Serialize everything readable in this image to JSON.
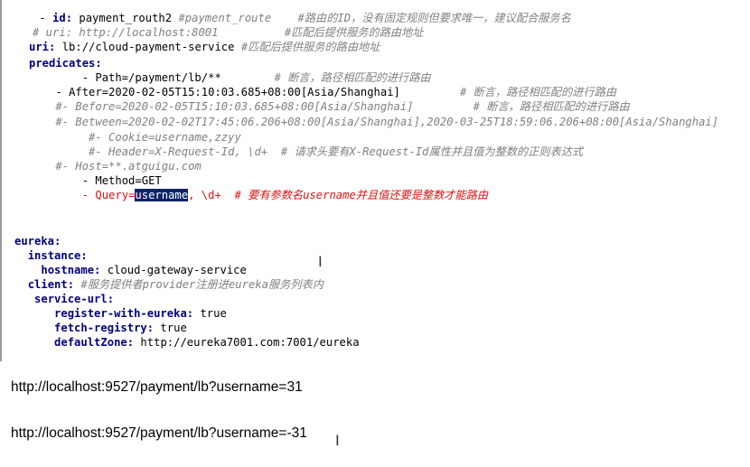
{
  "code": {
    "l1": {
      "dash": "    - ",
      "key": "id:",
      "val": " payment_routh2 ",
      "comment": "#payment_route    #路由的ID，没有固定规则但要求唯一，建议配合服务名"
    },
    "l2": {
      "comment": "   # uri: http://localhost:8001          #匹配后提供服务的路由地址"
    },
    "l3": {
      "indent": "   ",
      "key": "uri:",
      "val": " lb://cloud-payment-service ",
      "comment": "#匹配后提供服务的路由地址"
    },
    "l4": {
      "indent": "   ",
      "key": "predicates:"
    },
    "l5": {
      "val": "        - Path=/payment/lb/**        ",
      "comment": "# 断言，路径相匹配的进行路由"
    },
    "l6": {
      "val": "    - After=2020-02-05T15:10:03.685+08:00[Asia/Shanghai]         ",
      "comment": "# 断言，路径相匹配的进行路由"
    },
    "l7": {
      "comment": "    #- Before=2020-02-05T15:10:03.685+08:00[Asia/Shanghai]         # 断言，路径相匹配的进行路由"
    },
    "l8": {
      "comment": "    #- Between=2020-02-02T17:45:06.206+08:00[Asia/Shanghai],2020-03-25T18:59:06.206+08:00[Asia/Shanghai]"
    },
    "l9": {
      "comment": "         #- Cookie=username,zzyy"
    },
    "l10": {
      "comment": "         #- Header=X-Request-Id, \\d+  # 请求头要有X-Request-Id属性并且值为整数的正则表达式"
    },
    "l11": {
      "comment": "    #- Host=**.atguigu.com"
    },
    "l12": {
      "val": "        - Method=GET"
    },
    "l13": {
      "pre": "        - Query=",
      "selected": "username",
      "post": ", \\d+  ",
      "comment": "# 要有参数名username并且值还要是整数才能路由"
    },
    "l14": {
      "key": "eureka:"
    },
    "l15": {
      "indent": "  ",
      "key": "instance:"
    },
    "l16": {
      "indent": "    ",
      "key": "hostname:",
      "val": " cloud-gateway-service"
    },
    "l17": {
      "indent": "  ",
      "key": "client:",
      "val": " ",
      "comment": "#服务提供者provider注册进eureka服务列表内"
    },
    "l18": {
      "indent": "   ",
      "key": "service-url:"
    },
    "l19": {
      "indent": "      ",
      "key": "register-with-eureka:",
      "val": " true"
    },
    "l20": {
      "indent": "      ",
      "key": "fetch-registry:",
      "val": " true"
    },
    "l21": {
      "indent": "      ",
      "key": "defaultZone:",
      "val": " http://eureka7001.com:7001/eureka"
    }
  },
  "bottom": {
    "url1": "http://localhost:9527/payment/lb?username=31",
    "url2": "http://localhost:9527/payment/lb?username=-31"
  },
  "colors": {
    "key": "#000080",
    "comment": "#808080",
    "red": "#e01010",
    "selection": "#0a246a"
  }
}
